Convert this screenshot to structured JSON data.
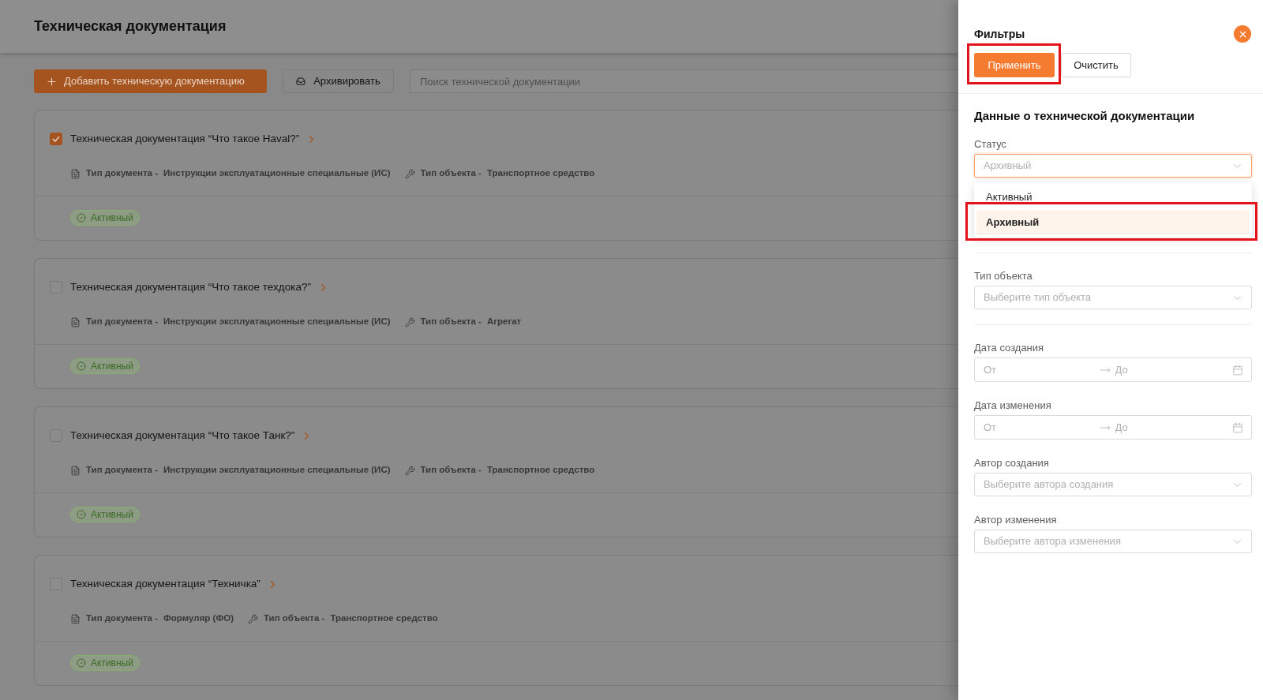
{
  "header": {
    "title": "Техническая документация"
  },
  "toolbar": {
    "add_button": {
      "label": "Добавить техническую документацию"
    },
    "archive_button": {
      "label": "Архивировать"
    },
    "search": {
      "placeholder": "Поиск технической документации"
    }
  },
  "documents": [
    {
      "title": "Техническая документация “Что такое Haval?”",
      "checked": true,
      "meta": [
        {
          "kind": "document",
          "label": "Тип документа -",
          "value": "Инструкции эксплуатационные специальные (ИС)"
        },
        {
          "kind": "object",
          "label": "Тип объекта -",
          "value": "Транспортное средство"
        }
      ],
      "status": "Активный"
    },
    {
      "title": "Техническая документация “Что такое техдока?”",
      "checked": false,
      "meta": [
        {
          "kind": "document",
          "label": "Тип документа -",
          "value": "Инструкции эксплуатационные специальные (ИС)"
        },
        {
          "kind": "object",
          "label": "Тип объекта -",
          "value": "Агрегат"
        }
      ],
      "status": "Активный"
    },
    {
      "title": "Техническая документация “Что такое Танк?”",
      "checked": false,
      "meta": [
        {
          "kind": "document",
          "label": "Тип документа -",
          "value": "Инструкции эксплуатационные специальные (ИС)"
        },
        {
          "kind": "object",
          "label": "Тип объекта -",
          "value": "Транспортное средство"
        }
      ],
      "status": "Активный"
    },
    {
      "title": "Техническая документация “Техничка”",
      "checked": false,
      "meta": [
        {
          "kind": "document",
          "label": "Тип документа -",
          "value": "Формуляр (ФО)"
        },
        {
          "kind": "object",
          "label": "Тип объекта -",
          "value": "Транспортное средство"
        }
      ],
      "status": "Активный"
    }
  ],
  "filters": {
    "title": "Фильтры",
    "buttons": [
      {
        "label": "Применить",
        "kind": "primary",
        "highlighted": true
      },
      {
        "label": "Очистить",
        "kind": "default",
        "highlighted": false
      }
    ],
    "section_title": "Данные о технической документации",
    "groups": [
      {
        "fields": [
          {
            "kind": "select",
            "label": "Статус",
            "value": "Архивный",
            "open": true,
            "options": [
              {
                "label": "Активный",
                "selected": false,
                "highlighted": false
              },
              {
                "label": "Архивный",
                "selected": true,
                "highlighted": true
              }
            ]
          }
        ]
      },
      {
        "fields": [
          {
            "kind": "select",
            "label": "Тип объекта",
            "placeholder": "Выберите тип объекта",
            "open": false
          }
        ]
      },
      {
        "fields": [
          {
            "kind": "date_range",
            "label": "Дата создания",
            "from_placeholder": "От",
            "to_placeholder": "До"
          },
          {
            "kind": "date_range",
            "label": "Дата изменения",
            "from_placeholder": "От",
            "to_placeholder": "До"
          },
          {
            "kind": "select",
            "label": "Автор создания",
            "placeholder": "Выберите автора создания",
            "open": false
          },
          {
            "kind": "select",
            "label": "Автор изменения",
            "placeholder": "Выберите автора изменения",
            "open": false
          }
        ]
      }
    ]
  }
}
